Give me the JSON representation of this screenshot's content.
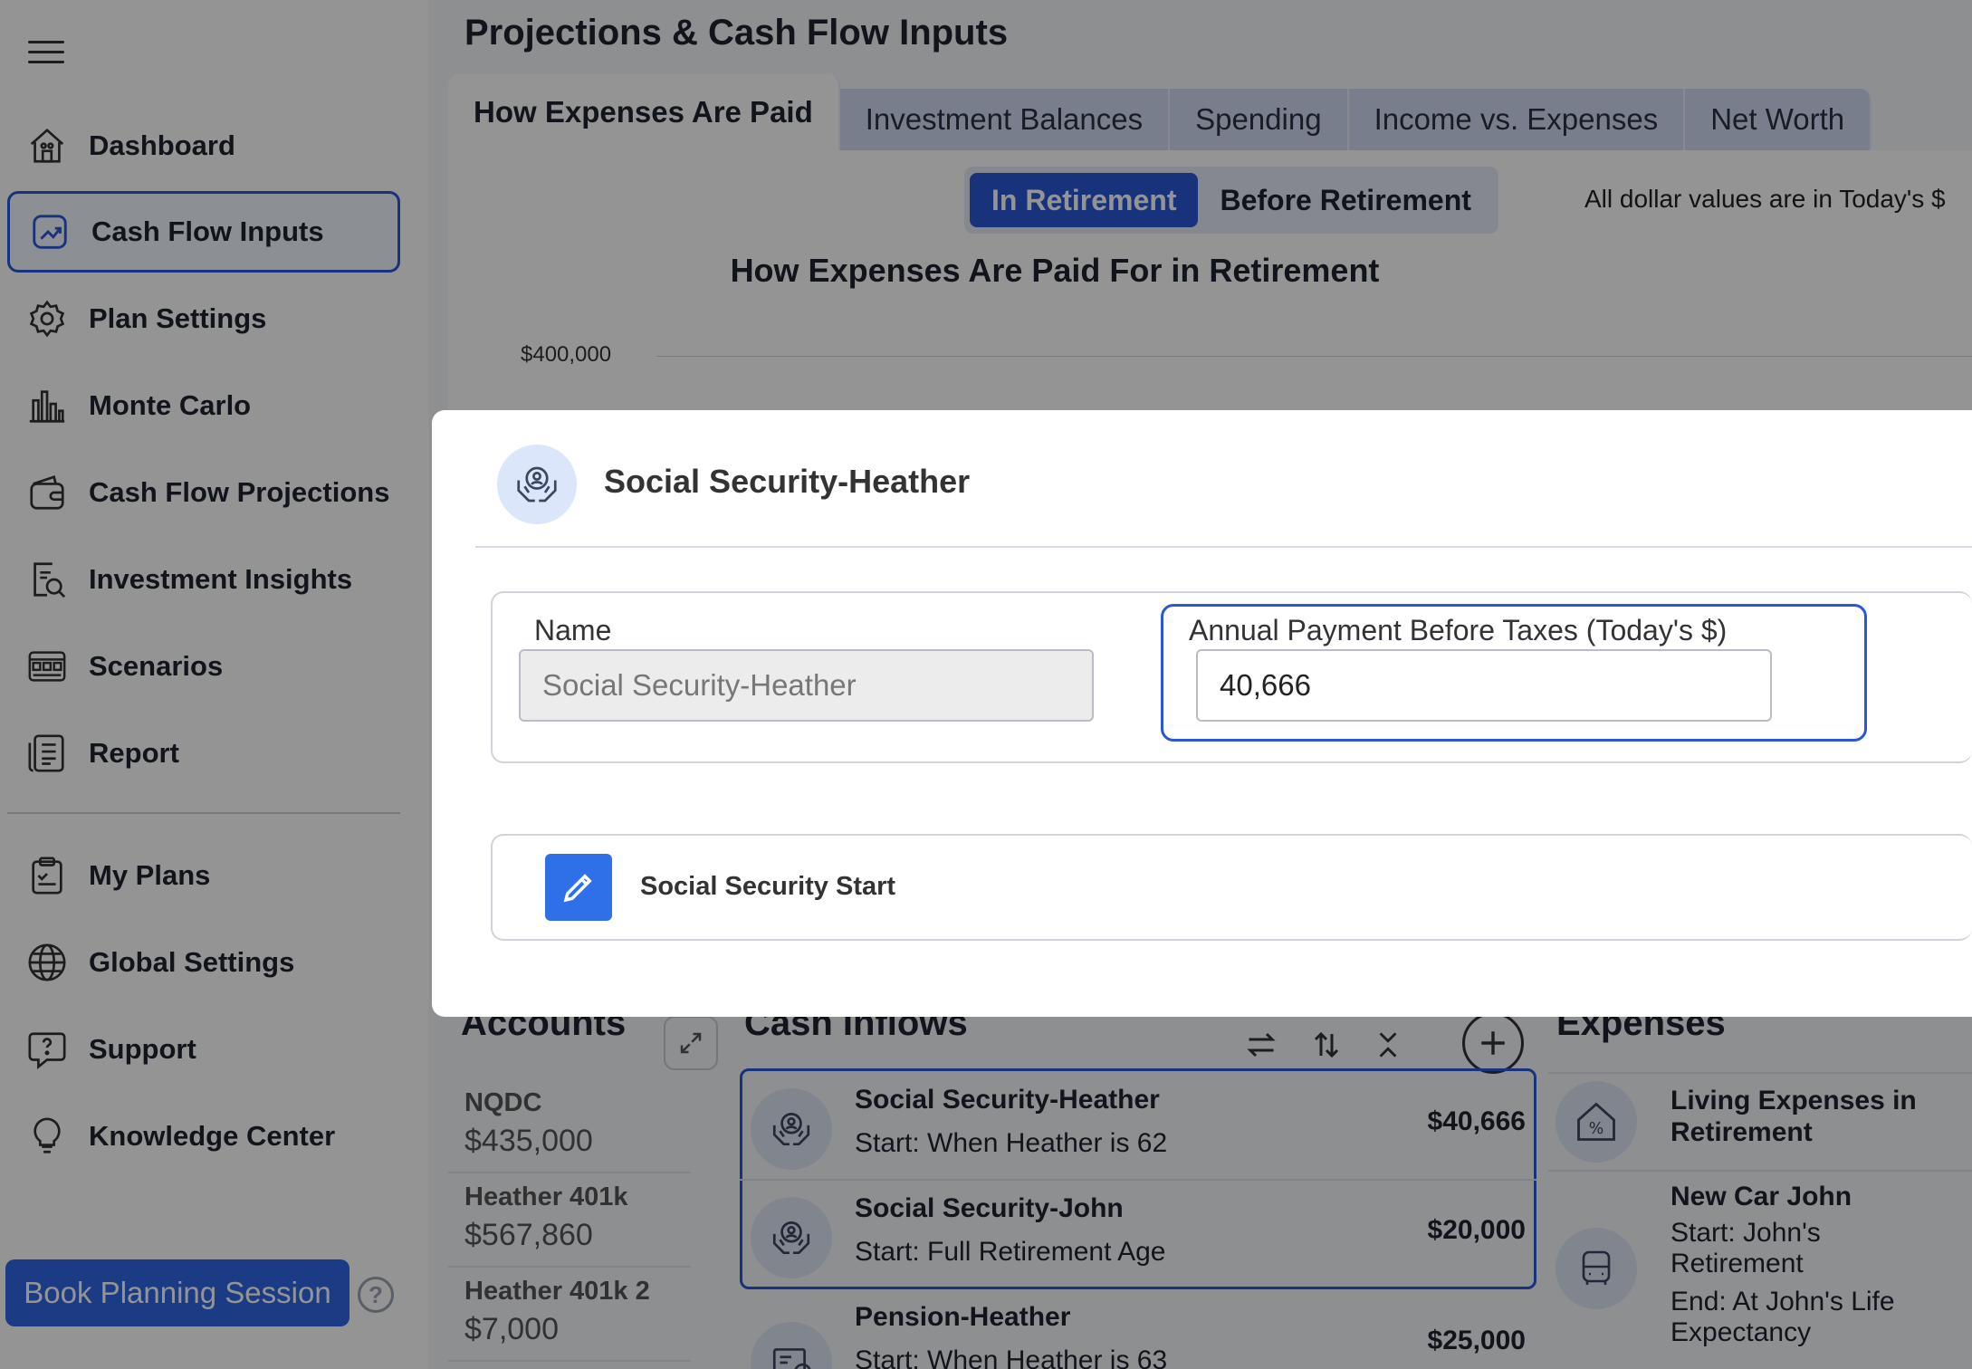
{
  "sidebar": {
    "items": [
      {
        "label": "Dashboard"
      },
      {
        "label": "Cash Flow Inputs"
      },
      {
        "label": "Plan Settings"
      },
      {
        "label": "Monte Carlo"
      },
      {
        "label": "Cash Flow Projections"
      },
      {
        "label": "Investment Insights"
      },
      {
        "label": "Scenarios"
      },
      {
        "label": "Report"
      },
      {
        "label": "My Plans"
      },
      {
        "label": "Global Settings"
      },
      {
        "label": "Support"
      },
      {
        "label": "Knowledge Center"
      }
    ],
    "active_item": "Cash Flow Inputs",
    "book_button": "Book Planning Session",
    "help_glyph": "?"
  },
  "header": {
    "title": "Projections & Cash Flow Inputs"
  },
  "tabs": [
    {
      "label": "How Expenses Are Paid",
      "active": true
    },
    {
      "label": "Investment Balances",
      "active": false
    },
    {
      "label": "Spending",
      "active": false
    },
    {
      "label": "Income vs. Expenses",
      "active": false
    },
    {
      "label": "Net Worth",
      "active": false
    }
  ],
  "chart_panel": {
    "toggle": {
      "on": "In Retirement",
      "off": "Before Retirement"
    },
    "note": "All dollar values are in Today's $",
    "title": "How Expenses Are Paid For in Retirement",
    "ytick": "$400,000"
  },
  "accounts": {
    "title": "Accounts",
    "items": [
      {
        "name": "NQDC",
        "value": "$435,000"
      },
      {
        "name": "Heather 401k",
        "value": "$567,860"
      },
      {
        "name": "Heather 401k 2",
        "value": "$7,000"
      }
    ]
  },
  "cash_inflows": {
    "title": "Cash Inflows",
    "items": [
      {
        "name": "Social Security-Heather",
        "start": "Start: When Heather is 62",
        "amount": "$40,666"
      },
      {
        "name": "Social Security-John",
        "start": "Start: Full Retirement Age",
        "amount": "$20,000"
      },
      {
        "name": "Pension-Heather",
        "start": "Start: When Heather is 63",
        "amount": "$25,000"
      }
    ]
  },
  "expenses": {
    "title": "Expenses",
    "items": [
      {
        "name": "Living Expenses in",
        "name2": "Retirement"
      },
      {
        "name": "New Car John",
        "l2": "Start: John's",
        "l3": "Retirement",
        "l4": "End: At John's Life",
        "l5": "Expectancy"
      }
    ]
  },
  "modal": {
    "title": "Social Security-Heather",
    "name_label": "Name",
    "name_value": "Social Security-Heather",
    "payment_label": "Annual Payment Before Taxes (Today's $)",
    "payment_value": "40,666",
    "section_label": "Social Security Start"
  },
  "colors": {
    "accent": "#2b57d6",
    "primary_button": "#2f66e6",
    "overlay": "rgba(0,0,0,0.42)"
  }
}
